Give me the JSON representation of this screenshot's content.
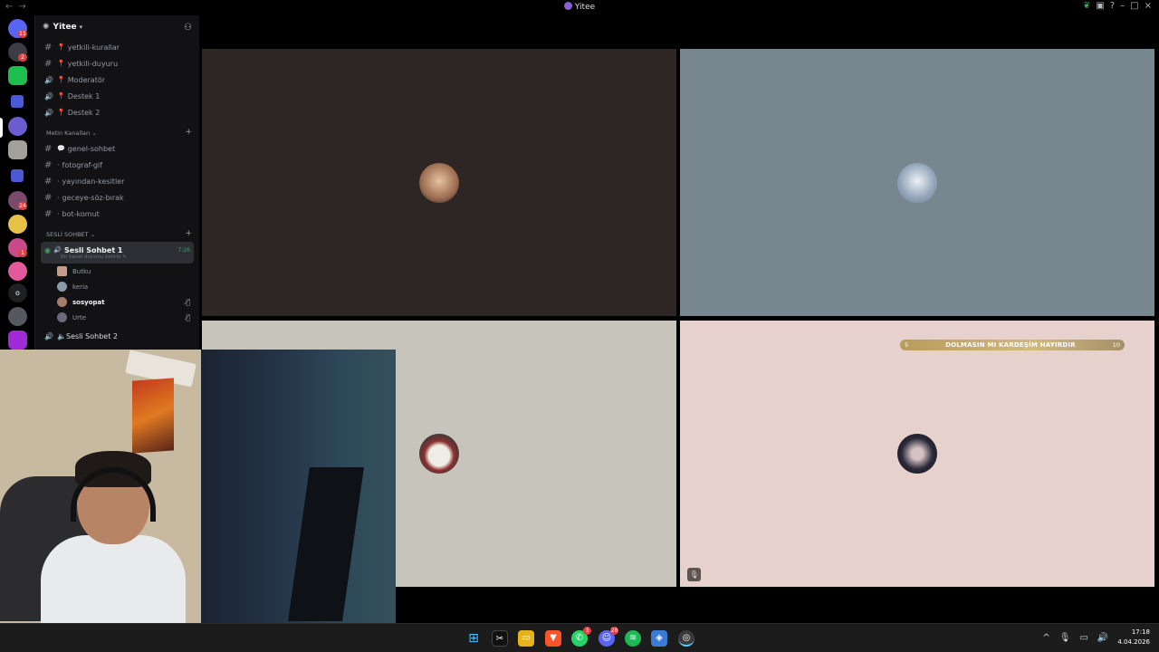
{
  "window": {
    "title": "Yitee",
    "controls": [
      "leaf-icon",
      "app-icon",
      "help-icon",
      "minimize",
      "maximize",
      "close"
    ]
  },
  "server": {
    "name": "Yitee"
  },
  "rail": {
    "badges": [
      "11",
      "2",
      "24",
      "1"
    ]
  },
  "channels_top": [
    {
      "type": "text",
      "label": "yetkili-kurallar",
      "pin": true
    },
    {
      "type": "text",
      "label": "yetkili-duyuru",
      "pin": true
    },
    {
      "type": "voice",
      "label": "Moderatör",
      "pin": true
    },
    {
      "type": "voice",
      "label": "Destek 1",
      "pin": true
    },
    {
      "type": "voice",
      "label": "Destek 2",
      "pin": true
    }
  ],
  "text_category": {
    "label": "Metin Kanalları",
    "channels": [
      {
        "label": "genel-sohbet",
        "bubble": true
      },
      {
        "label": "fotograf-gif"
      },
      {
        "label": "yayından-kesitler"
      },
      {
        "label": "geceye-söz-bırak"
      },
      {
        "label": "bot-komut"
      }
    ]
  },
  "voice_category": {
    "label": "SESLİ SOHBET",
    "active_channel": {
      "label": "Sesli Sohbet 1",
      "time": "7:26",
      "status": "Bir kanal durumu belirle"
    },
    "users": [
      {
        "name": "Butku",
        "color": "#c89a8a",
        "muted": false,
        "bold": false
      },
      {
        "name": "keria",
        "color": "#8b9aa8",
        "muted": false,
        "bold": false
      },
      {
        "name": "sosyopat",
        "color": "#a87a6a",
        "muted": true,
        "bold": true
      },
      {
        "name": "Urte",
        "color": "#6a6a7a",
        "muted": true,
        "bold": false
      }
    ],
    "next_channel": "Sesli Sohbet 2"
  },
  "stage": {
    "tiles": [
      {
        "name": "tile-1",
        "avatar_color": "#c9a182"
      },
      {
        "name": "tile-2",
        "avatar_color": "#c9d2de"
      },
      {
        "name": "tile-3",
        "avatar_color": "#8b2f2f"
      },
      {
        "name": "tile-4",
        "avatar_color": "#2a2a3a"
      }
    ],
    "boost_bar": {
      "left": "5",
      "message": "DOLMASIN MI KARDEŞİM HAYIRDIR",
      "right": "10"
    }
  },
  "taskbar": {
    "apps": [
      "windows-start",
      "capcut",
      "file-explorer",
      "brave",
      "whatsapp",
      "discord",
      "spotify",
      "network-tool",
      "discord-dev"
    ],
    "badges": {
      "whatsapp": "3",
      "discord": "28"
    },
    "time": "17:18",
    "date": "4.04.2026"
  }
}
